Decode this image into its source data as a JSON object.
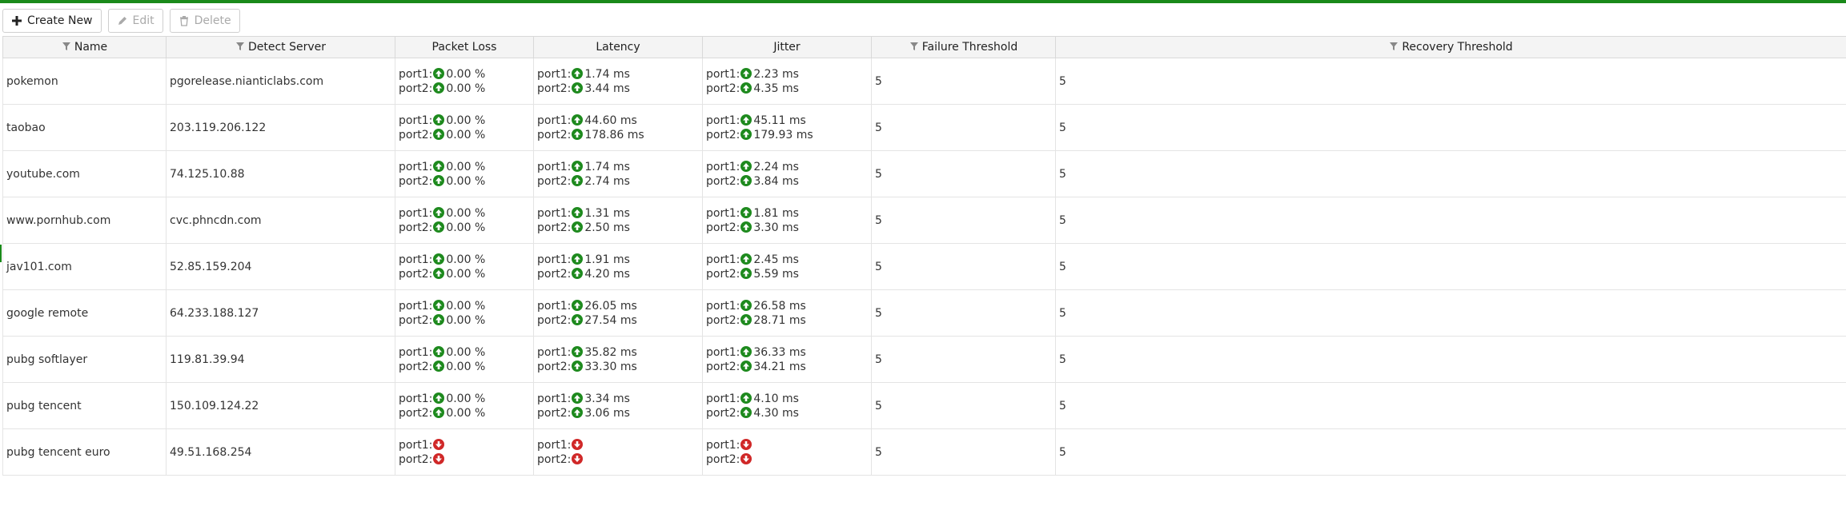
{
  "toolbar": {
    "create_label": "Create New",
    "edit_label": "Edit",
    "delete_label": "Delete"
  },
  "columns": {
    "name": "Name",
    "detect_server": "Detect Server",
    "packet_loss": "Packet Loss",
    "latency": "Latency",
    "jitter": "Jitter",
    "failure_threshold": "Failure Threshold",
    "recovery_threshold": "Recovery Threshold"
  },
  "status_colors": {
    "up": "#1e8a1e",
    "down": "#d02828"
  },
  "rows": [
    {
      "name": "pokemon",
      "server": "pgorelease.nianticlabs.com",
      "loss": [
        {
          "port": "port1:",
          "status": "up",
          "value": "0.00 %"
        },
        {
          "port": "port2:",
          "status": "up",
          "value": "0.00 %"
        }
      ],
      "latency": [
        {
          "port": "port1:",
          "status": "up",
          "value": "1.74 ms"
        },
        {
          "port": "port2:",
          "status": "up",
          "value": "3.44 ms"
        }
      ],
      "jitter": [
        {
          "port": "port1:",
          "status": "up",
          "value": "2.23 ms"
        },
        {
          "port": "port2:",
          "status": "up",
          "value": "4.35 ms"
        }
      ],
      "failure": "5",
      "recovery": "5"
    },
    {
      "name": "taobao",
      "server": "203.119.206.122",
      "loss": [
        {
          "port": "port1:",
          "status": "up",
          "value": "0.00 %"
        },
        {
          "port": "port2:",
          "status": "up",
          "value": "0.00 %"
        }
      ],
      "latency": [
        {
          "port": "port1:",
          "status": "up",
          "value": "44.60 ms"
        },
        {
          "port": "port2:",
          "status": "up",
          "value": "178.86 ms"
        }
      ],
      "jitter": [
        {
          "port": "port1:",
          "status": "up",
          "value": "45.11 ms"
        },
        {
          "port": "port2:",
          "status": "up",
          "value": "179.93 ms"
        }
      ],
      "failure": "5",
      "recovery": "5"
    },
    {
      "name": "youtube.com",
      "server": "74.125.10.88",
      "loss": [
        {
          "port": "port1:",
          "status": "up",
          "value": "0.00 %"
        },
        {
          "port": "port2:",
          "status": "up",
          "value": "0.00 %"
        }
      ],
      "latency": [
        {
          "port": "port1:",
          "status": "up",
          "value": "1.74 ms"
        },
        {
          "port": "port2:",
          "status": "up",
          "value": "2.74 ms"
        }
      ],
      "jitter": [
        {
          "port": "port1:",
          "status": "up",
          "value": "2.24 ms"
        },
        {
          "port": "port2:",
          "status": "up",
          "value": "3.84 ms"
        }
      ],
      "failure": "5",
      "recovery": "5"
    },
    {
      "name": "www.pornhub.com",
      "server": "cvc.phncdn.com",
      "loss": [
        {
          "port": "port1:",
          "status": "up",
          "value": "0.00 %"
        },
        {
          "port": "port2:",
          "status": "up",
          "value": "0.00 %"
        }
      ],
      "latency": [
        {
          "port": "port1:",
          "status": "up",
          "value": "1.31 ms"
        },
        {
          "port": "port2:",
          "status": "up",
          "value": "2.50 ms"
        }
      ],
      "jitter": [
        {
          "port": "port1:",
          "status": "up",
          "value": "1.81 ms"
        },
        {
          "port": "port2:",
          "status": "up",
          "value": "3.30 ms"
        }
      ],
      "failure": "5",
      "recovery": "5"
    },
    {
      "name": "jav101.com",
      "server": "52.85.159.204",
      "loss": [
        {
          "port": "port1:",
          "status": "up",
          "value": "0.00 %"
        },
        {
          "port": "port2:",
          "status": "up",
          "value": "0.00 %"
        }
      ],
      "latency": [
        {
          "port": "port1:",
          "status": "up",
          "value": "1.91 ms"
        },
        {
          "port": "port2:",
          "status": "up",
          "value": "4.20 ms"
        }
      ],
      "jitter": [
        {
          "port": "port1:",
          "status": "up",
          "value": "2.45 ms"
        },
        {
          "port": "port2:",
          "status": "up",
          "value": "5.59 ms"
        }
      ],
      "failure": "5",
      "recovery": "5"
    },
    {
      "name": "google remote",
      "server": "64.233.188.127",
      "loss": [
        {
          "port": "port1:",
          "status": "up",
          "value": "0.00 %"
        },
        {
          "port": "port2:",
          "status": "up",
          "value": "0.00 %"
        }
      ],
      "latency": [
        {
          "port": "port1:",
          "status": "up",
          "value": "26.05 ms"
        },
        {
          "port": "port2:",
          "status": "up",
          "value": "27.54 ms"
        }
      ],
      "jitter": [
        {
          "port": "port1:",
          "status": "up",
          "value": "26.58 ms"
        },
        {
          "port": "port2:",
          "status": "up",
          "value": "28.71 ms"
        }
      ],
      "failure": "5",
      "recovery": "5"
    },
    {
      "name": "pubg softlayer",
      "server": "119.81.39.94",
      "loss": [
        {
          "port": "port1:",
          "status": "up",
          "value": "0.00 %"
        },
        {
          "port": "port2:",
          "status": "up",
          "value": "0.00 %"
        }
      ],
      "latency": [
        {
          "port": "port1:",
          "status": "up",
          "value": "35.82 ms"
        },
        {
          "port": "port2:",
          "status": "up",
          "value": "33.30 ms"
        }
      ],
      "jitter": [
        {
          "port": "port1:",
          "status": "up",
          "value": "36.33 ms"
        },
        {
          "port": "port2:",
          "status": "up",
          "value": "34.21 ms"
        }
      ],
      "failure": "5",
      "recovery": "5"
    },
    {
      "name": "pubg tencent",
      "server": "150.109.124.22",
      "loss": [
        {
          "port": "port1:",
          "status": "up",
          "value": "0.00 %"
        },
        {
          "port": "port2:",
          "status": "up",
          "value": "0.00 %"
        }
      ],
      "latency": [
        {
          "port": "port1:",
          "status": "up",
          "value": "3.34 ms"
        },
        {
          "port": "port2:",
          "status": "up",
          "value": "3.06 ms"
        }
      ],
      "jitter": [
        {
          "port": "port1:",
          "status": "up",
          "value": "4.10 ms"
        },
        {
          "port": "port2:",
          "status": "up",
          "value": "4.30 ms"
        }
      ],
      "failure": "5",
      "recovery": "5"
    },
    {
      "name": "pubg tencent euro",
      "server": "49.51.168.254",
      "loss": [
        {
          "port": "port1:",
          "status": "down",
          "value": ""
        },
        {
          "port": "port2:",
          "status": "down",
          "value": ""
        }
      ],
      "latency": [
        {
          "port": "port1:",
          "status": "down",
          "value": ""
        },
        {
          "port": "port2:",
          "status": "down",
          "value": ""
        }
      ],
      "jitter": [
        {
          "port": "port1:",
          "status": "down",
          "value": ""
        },
        {
          "port": "port2:",
          "status": "down",
          "value": ""
        }
      ],
      "failure": "5",
      "recovery": "5"
    }
  ]
}
